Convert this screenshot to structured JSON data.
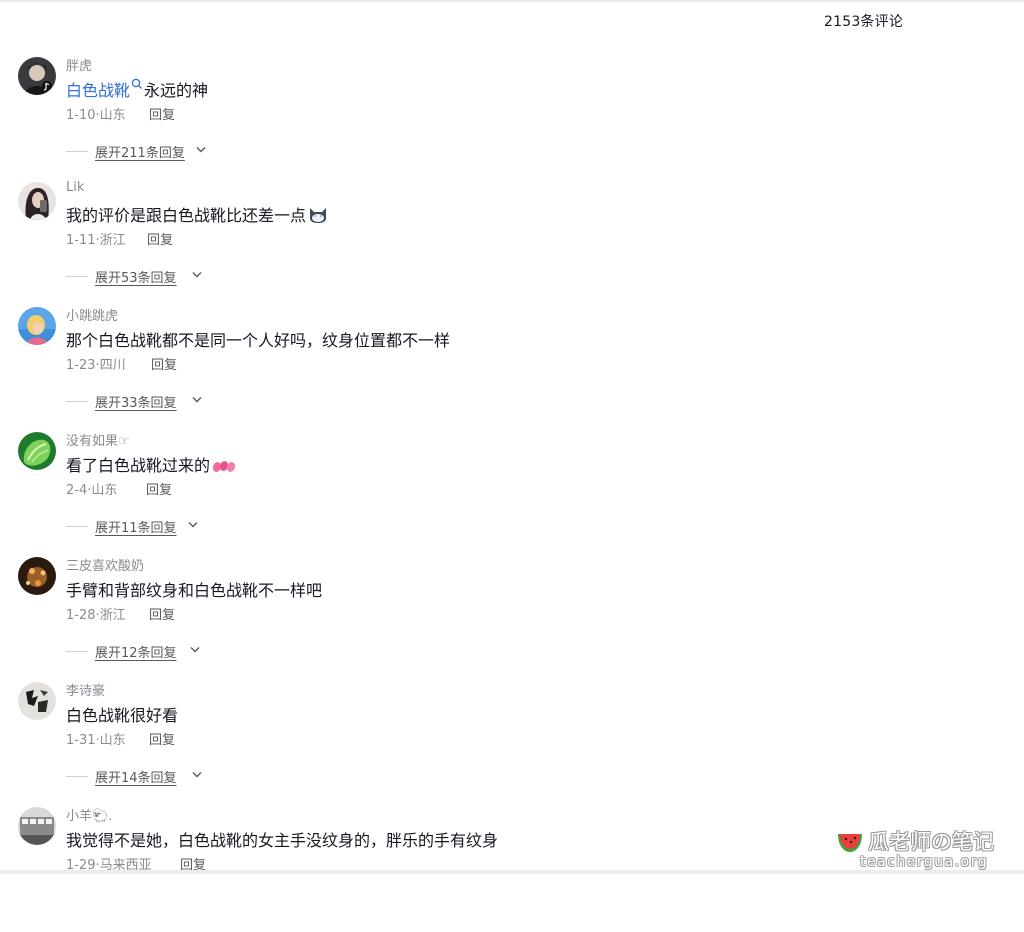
{
  "header": {
    "comment_count": "2153条评论"
  },
  "comments": [
    {
      "user": "胖虎",
      "text_keyword": "白色战靴",
      "text_rest": "永远的神",
      "date": "1-10",
      "location": "山东",
      "reply": "回复",
      "expand": "展开211条回复"
    },
    {
      "user": "Lik",
      "text": "我的评价是跟白色战靴比还差一点",
      "emoji": "cat-face-emoji",
      "date": "1-11",
      "location": "浙江",
      "reply": "回复",
      "expand": "展开53条回复"
    },
    {
      "user": "小跳跳虎",
      "text": "那个白色战靴都不是同一个人好吗，纹身位置都不一样",
      "date": "1-23",
      "location": "四川",
      "reply": "回复",
      "expand": "展开33条回复"
    },
    {
      "user": "没有如果☞",
      "text": "看了白色战靴过来的",
      "emoji": "pink-blobs-emoji",
      "date": "2-4",
      "location": "山东",
      "reply": "回复",
      "expand": "展开11条回复"
    },
    {
      "user": "三皮喜欢酸奶",
      "text": "手臂和背部纹身和白色战靴不一样吧",
      "date": "1-28",
      "location": "浙江",
      "reply": "回复",
      "expand": "展开12条回复"
    },
    {
      "user": "李诗豪",
      "text": "白色战靴很好看",
      "date": "1-31",
      "location": "山东",
      "reply": "回复",
      "expand": "展开14条回复"
    },
    {
      "user": "小羊🐑.",
      "text": "我觉得不是她，白色战靴的女主手没纹身的，胖乐的手有纹身",
      "date": "1-29",
      "location": "马来西亚",
      "reply": "回复"
    }
  ],
  "separator": "·",
  "colors": {
    "keyword": "#2f6fd6",
    "secondary_text": "#8a8b91",
    "primary_text": "#161823"
  },
  "watermark": {
    "name": "瓜老师の笔记",
    "url": "teachergua.org",
    "icon": "watermelon-icon"
  }
}
